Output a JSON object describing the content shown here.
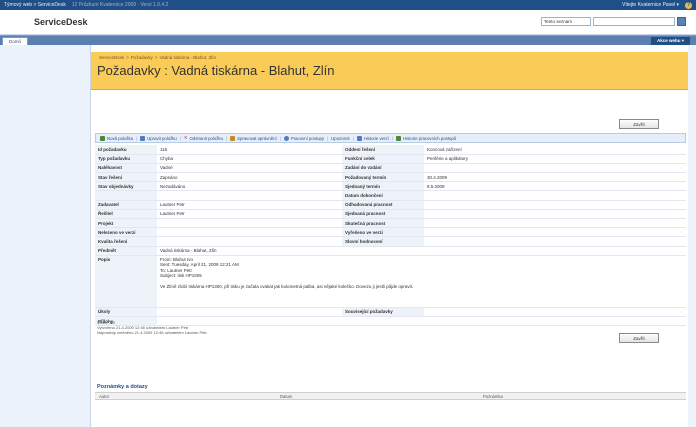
{
  "topbar": {
    "site": "Týmový web > ServiceDesk",
    "status": "12 Průzkum Kvaternice 2009 · Verzi 1.9.4.2",
    "user": "Vítejte Kvaternice Pavel ▾",
    "help": "?"
  },
  "header": {
    "site_name": "ServiceDesk",
    "search_scope": "Tento seznam"
  },
  "nav": {
    "tab": "Domů",
    "site_actions": "Akce webu ▾"
  },
  "title": {
    "breadcrumb": [
      "ServiceDesk",
      ">",
      "Požadavky",
      ">",
      "Vadná tiskárna - Blahut, Zlín"
    ],
    "text": "Požadavky : Vadná tiskárna - Blahut, Zlín"
  },
  "buttons": {
    "close": "Zavřít"
  },
  "toolbar": {
    "items": [
      {
        "label": "Nová položka",
        "icon": "new-item-icon",
        "color": "#4a8a3a"
      },
      {
        "label": "Upravit položku",
        "icon": "edit-item-icon",
        "color": "#4f7dbf"
      },
      {
        "label": "Odstranit položku",
        "icon": "delete-item-icon",
        "color": "#b03030"
      },
      {
        "label": "Spravovat oprávnění",
        "icon": "permissions-icon",
        "color": "#c68a2a"
      },
      {
        "label": "Pracovní postupy",
        "icon": "workflow-icon",
        "color": "#4f7dbf"
      },
      {
        "label": "Upozornit",
        "icon": "",
        "color": ""
      },
      {
        "label": "Historie verzí",
        "icon": "version-history-icon",
        "color": "#4f7dbf"
      },
      {
        "label": "Historie pracovních postupů",
        "icon": "workflow-history-icon",
        "color": "#4a8a3a"
      }
    ]
  },
  "fields": {
    "id_label": "Id požadavku",
    "id_value": "116",
    "type_label": "Typ požadavku",
    "type_value": "Chyba",
    "urgency_label": "Naléhavost",
    "urgency_value": "Vadné",
    "state_label": "Stav řešení",
    "state_value": "Zapsáno",
    "order_label": "Stav objednávky",
    "order_value": "Nezadáváno",
    "requester_label": "Zadavatel",
    "requester_value": "Lautner Petr",
    "solver_label": "Řešitel",
    "solver_value": "Lautner Petr",
    "project_label": "Projekt",
    "project_value": "",
    "unverified_label": "Nelezeno ve verzi",
    "unverified_value": "",
    "quality_label": "Kvalita řešení",
    "quality_value": "",
    "subject_label": "Předmět",
    "subject_value": "Vadná tiskárna - Blahut, Zlín",
    "desc_label": "Popis",
    "desc_lines": [
      "From: Blahut Ivo",
      "Sent: Tuesday, April 21, 2009 12:21 AM",
      "To: Lautner Petr",
      "Subject: tisk HP1505",
      "",
      "Ve Zlíně zlobí tiskárna HP1300, při tisku je začala cvakat jak kulometná palba, asi nějaké kolečko. Dovezu ji jestli půjde opravit."
    ],
    "tasks_label": "Úkoly",
    "tasks_value": "",
    "attach_label": "Přílohy",
    "attach_value": "",
    "dept_label": "Oddení řešení",
    "dept_value": "Koncová zařízení",
    "func_label": "Funkční celek",
    "func_value": "Periférie a aplikátory",
    "entered_label": "Zadání do vzdání",
    "entered_value": "",
    "req_deadline_label": "Požadovaný termín",
    "req_deadline_value": "30.4.2009",
    "agreed_deadline_label": "Sjednaný termín",
    "agreed_deadline_value": "8.5.2009",
    "finished_label": "Datum dokončení",
    "finished_value": "",
    "estimated_label": "Odhadovaná pracnost",
    "estimated_value": "",
    "agreed_effort_label": "Sjednaná pracnost",
    "agreed_effort_value": "",
    "actual_effort_label": "Skutečná pracnost",
    "actual_effort_value": "",
    "solved_label": "Vyřešeno ve verzi",
    "solved_value": "",
    "comment_label": "Slovní hodnocení",
    "comment_value": "",
    "related_label": "Související požadavky",
    "related_value": ""
  },
  "meta": {
    "version": "Verze: 3.0",
    "created": "Vytvořeno 21.4.2009 12:46 uživatelem Lautner Petr",
    "modified": "Naposledy změněno 21.4.2009 12:46 uživatelem Lautner Petr"
  },
  "assoc": {
    "title": "Poznámky a dotazy",
    "col_author": "Autor",
    "col_date": "Datum",
    "col_note": "Poznámka"
  },
  "colors": {
    "accent": "#fbcb57",
    "nav": "#5c7fb0",
    "topbar": "#1f4f86"
  }
}
